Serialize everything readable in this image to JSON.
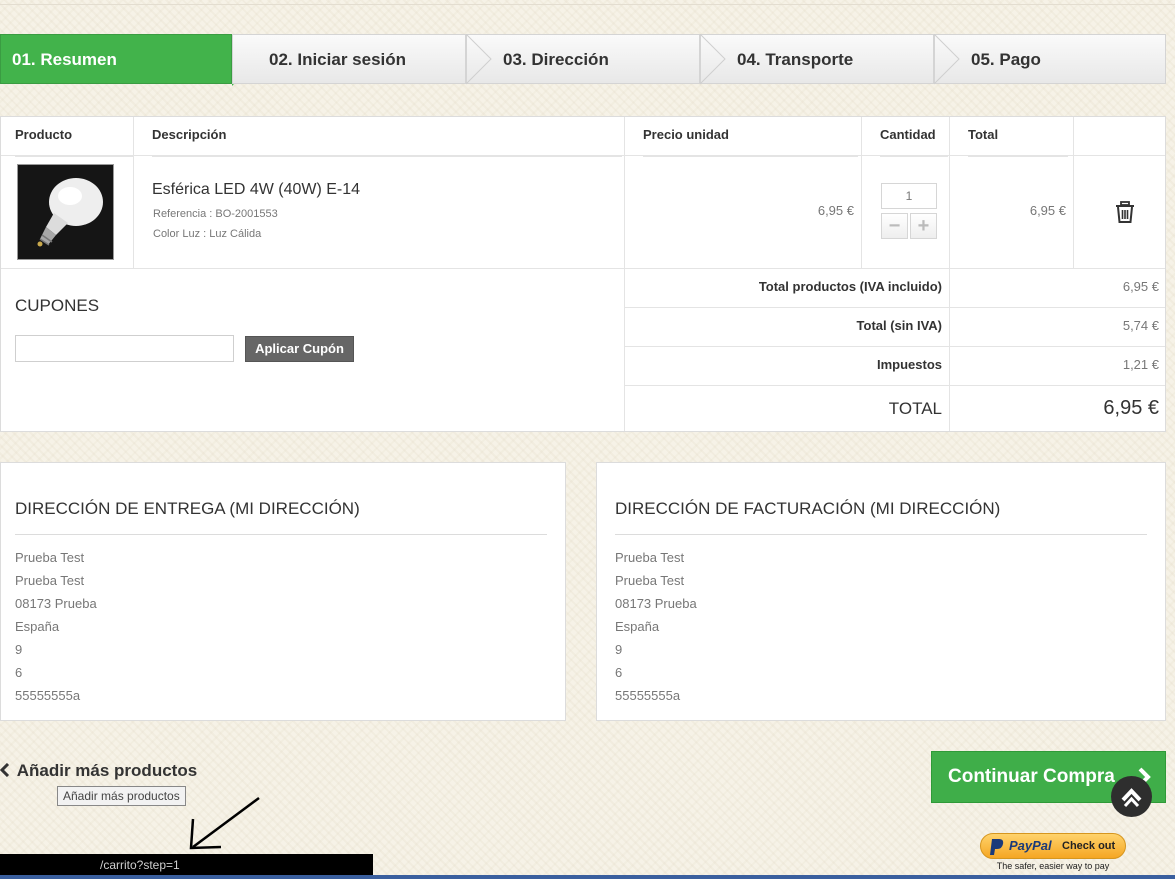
{
  "steps": [
    "01. Resumen",
    "02. Iniciar sesión",
    "03. Dirección",
    "04. Transporte",
    "05. Pago"
  ],
  "cart": {
    "headers": {
      "product": "Producto",
      "description": "Descripción",
      "unit_price": "Precio unidad",
      "quantity": "Cantidad",
      "total": "Total"
    },
    "item": {
      "name": "Esférica LED 4W (40W) E-14",
      "reference": "Referencia : BO-2001553",
      "color": "Color Luz : Luz Cálida",
      "unit_price": "6,95 €",
      "quantity": "1",
      "total": "6,95 €"
    },
    "summary": {
      "products_label": "Total productos (IVA incluido)",
      "products_value": "6,95 €",
      "net_label": "Total (sin IVA)",
      "net_value": "5,74 €",
      "tax_label": "Impuestos",
      "tax_value": "1,21 €",
      "total_label": "TOTAL",
      "total_value": "6,95 €"
    }
  },
  "coupons": {
    "title": "CUPONES",
    "input_value": "",
    "button_label": "Aplicar Cupón"
  },
  "delivery": {
    "title": "DIRECCIÓN DE ENTREGA (MI DIRECCIÓN)",
    "lines": [
      "Prueba Test",
      "Prueba Test",
      "08173 Prueba",
      "España",
      "9",
      "6",
      "55555555a"
    ]
  },
  "billing": {
    "title": "DIRECCIÓN DE FACTURACIÓN (MI DIRECCIÓN)",
    "lines": [
      "Prueba Test",
      "Prueba Test",
      "08173 Prueba",
      "España",
      "9",
      "6",
      "55555555a"
    ]
  },
  "footer": {
    "more_label": "Añadir más productos",
    "tooltip": "Añadir más productos",
    "continue_label": "Continuar Compra",
    "status_url": "/carrito?step=1",
    "paypal_brand": "PayPal",
    "paypal_checkout": "Check out",
    "paypal_tagline": "The safer, easier way to pay"
  },
  "colors": {
    "accent": "#42b34b",
    "button_dark": "#666666",
    "background": "#f6f2e7"
  }
}
